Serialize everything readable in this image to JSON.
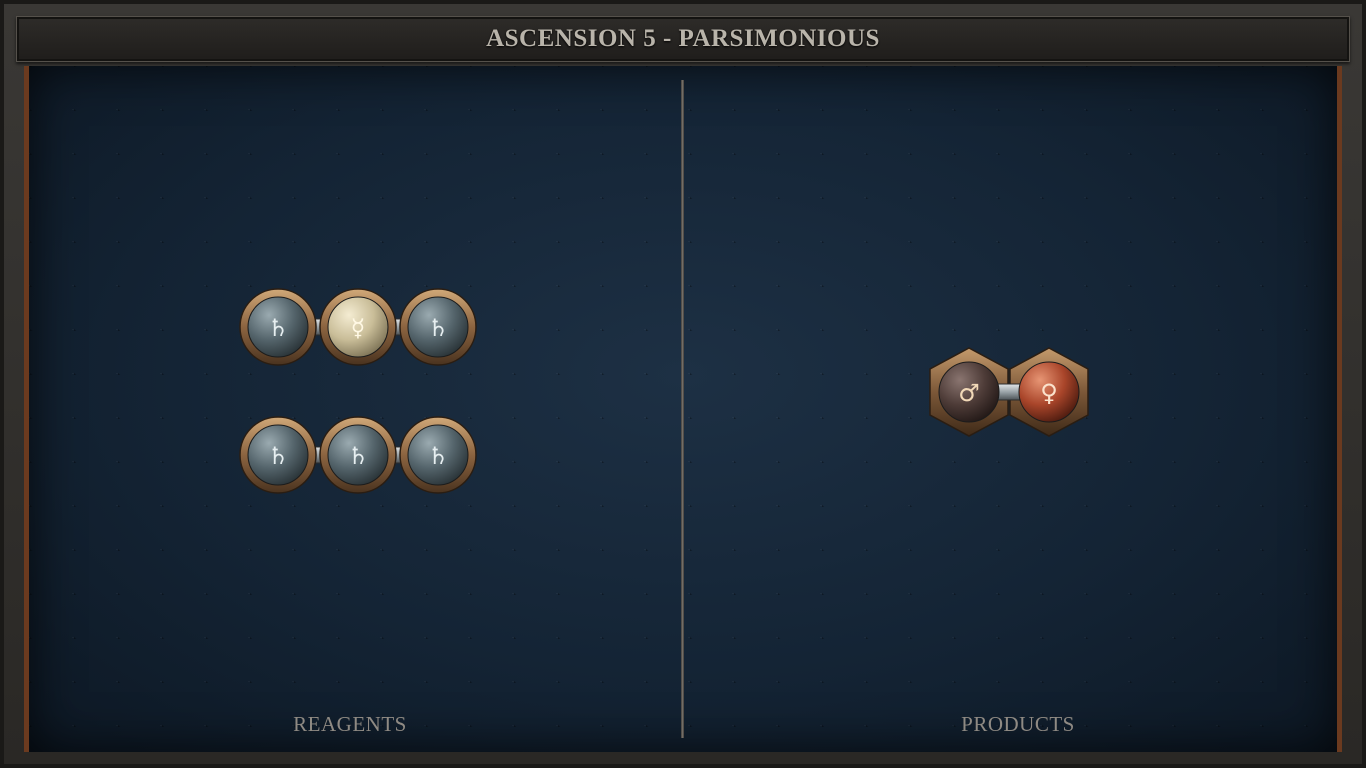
{
  "header": {
    "title": "ASCENSION 5 - PARSIMONIOUS"
  },
  "panels": {
    "reagents_label": "REAGENTS",
    "products_label": "PRODUCTS"
  },
  "reagents": [
    {
      "atoms": [
        {
          "element": "salt",
          "glyph": "♄"
        },
        {
          "element": "quicksilver",
          "glyph": "☿"
        },
        {
          "element": "salt",
          "glyph": "♄"
        }
      ]
    },
    {
      "atoms": [
        {
          "element": "salt",
          "glyph": "♄"
        },
        {
          "element": "salt",
          "glyph": "♄"
        },
        {
          "element": "salt",
          "glyph": "♄"
        }
      ]
    }
  ],
  "products": [
    {
      "atoms": [
        {
          "element": "iron",
          "glyph": "♂"
        },
        {
          "element": "copper",
          "glyph": "♀"
        }
      ]
    }
  ],
  "colors": {
    "board": "#132130",
    "accent_border": "#6b3a1f",
    "brass": "#a47a4f",
    "salt_orb": "#6f7f82",
    "quicksilver_orb": "#d8cfb0",
    "iron_orb": "#5a4440",
    "copper_orb": "#b04a2c",
    "label_text": "#8f8a83"
  }
}
